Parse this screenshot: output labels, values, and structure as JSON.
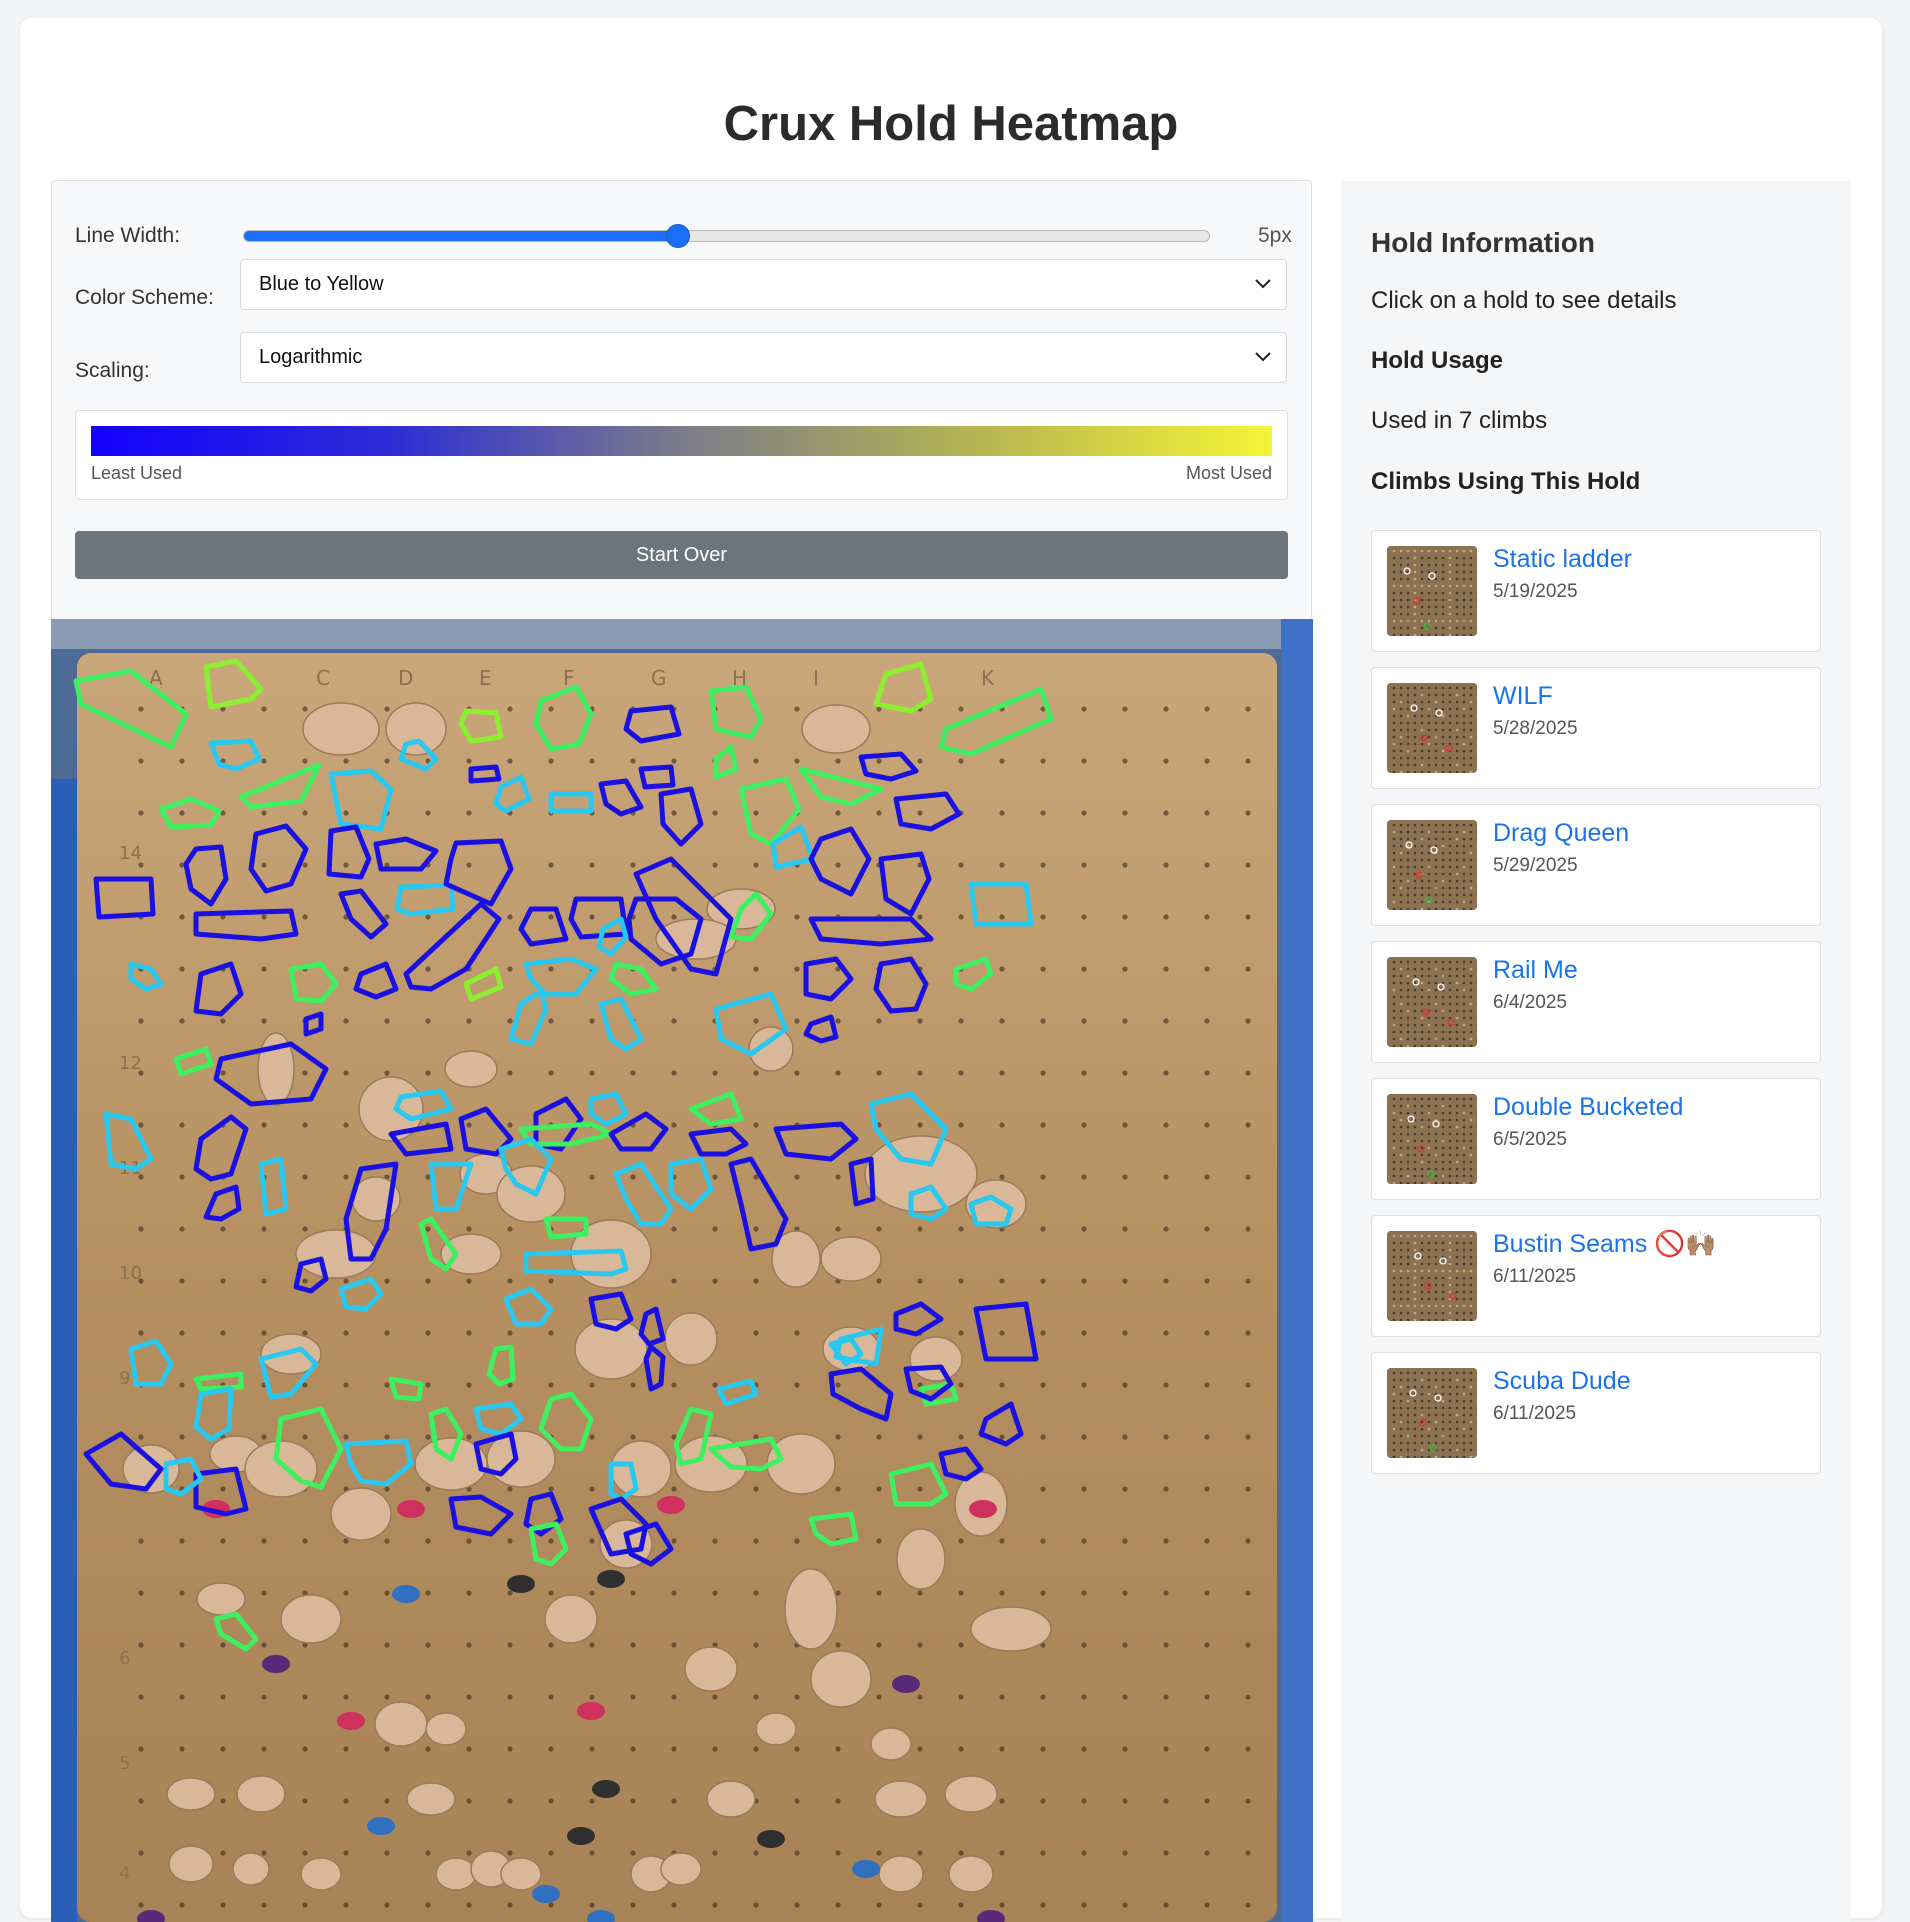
{
  "title": "Crux Hold Heatmap",
  "controls": {
    "line_width_label": "Line Width:",
    "line_width_value": "5px",
    "line_width_fraction": 0.45,
    "color_scheme_label": "Color Scheme:",
    "color_scheme_selected": "Blue to Yellow",
    "scaling_label": "Scaling:",
    "scaling_selected": "Logarithmic",
    "legend_left": "Least Used",
    "legend_right": "Most Used",
    "start_over_label": "Start Over",
    "accent_color": "#1a6ef7"
  },
  "info": {
    "heading": "Hold Information",
    "prompt": "Click on a hold to see details",
    "usage_heading": "Hold Usage",
    "usage_text": "Used in 7 climbs",
    "climbs_heading": "Climbs Using This Hold",
    "climbs": [
      {
        "name": "Static ladder",
        "date": "5/19/2025"
      },
      {
        "name": "WILF",
        "date": "5/28/2025"
      },
      {
        "name": "Drag Queen",
        "date": "5/29/2025"
      },
      {
        "name": "Rail Me",
        "date": "6/4/2025"
      },
      {
        "name": "Double Bucketed",
        "date": "6/5/2025"
      },
      {
        "name": "Bustin Seams 🚫🙌🏽",
        "date": "6/11/2025"
      },
      {
        "name": "Scuba Dude",
        "date": "6/11/2025"
      }
    ]
  },
  "board": {
    "column_labels": [
      "A",
      "C",
      "D",
      "E",
      "F",
      "G",
      "H",
      "I",
      "K"
    ],
    "row_labels": [
      "14",
      "12",
      "11",
      "10",
      "9",
      "6",
      "5",
      "4"
    ],
    "colors": {
      "low": "#1a10e0",
      "mid": "#28c8f0",
      "high": "#3cf060",
      "top": "#8cf030"
    }
  }
}
